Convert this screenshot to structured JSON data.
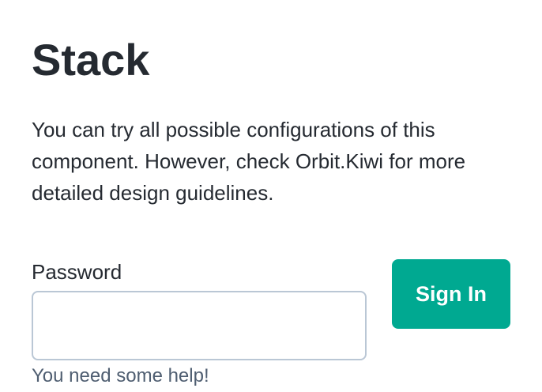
{
  "page": {
    "title": "Stack",
    "description": "You can try all possible configurations of this component. However, check Orbit.Kiwi for more detailed design guidelines."
  },
  "form": {
    "password_label": "Password",
    "password_value": "",
    "password_placeholder": "",
    "help_text": "You need some help!",
    "signin_label": "Sign In"
  },
  "colors": {
    "primary_button": "#00a991",
    "input_border": "#bac7d5",
    "heading_text": "#252a31",
    "help_text": "#4f5e71"
  }
}
